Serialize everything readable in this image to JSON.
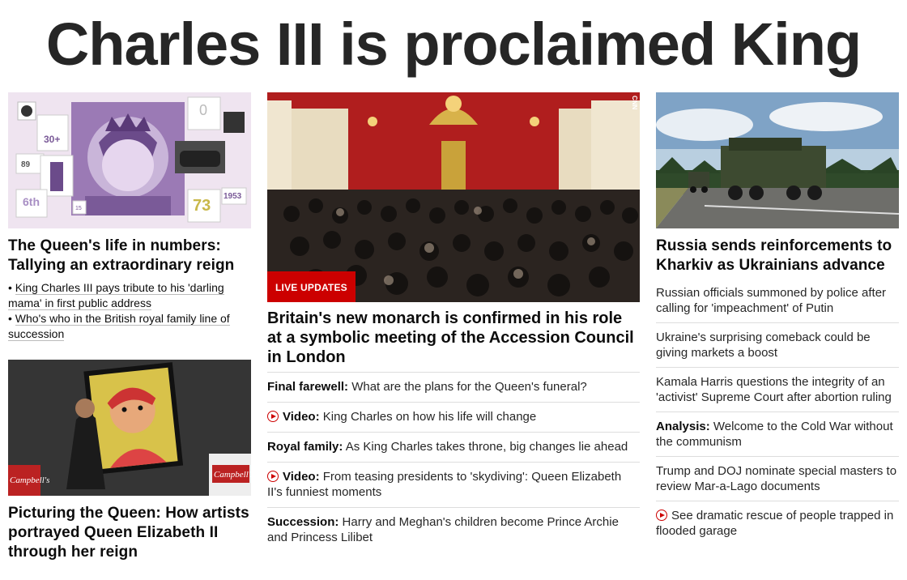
{
  "headline": "Charles III is proclaimed King",
  "left": {
    "card1": {
      "title": "The Queen's life in numbers: Tallying an extraordinary reign",
      "image_texts": [
        "30+",
        "89",
        "73",
        "1953",
        "6th",
        "0",
        "15"
      ],
      "links": [
        "King Charles III pays tribute to his 'darling mama' in first public address",
        "Who's who in the British royal family line of succession"
      ]
    },
    "card2": {
      "title": "Picturing the Queen: How artists portrayed Queen Elizabeth II through her reign",
      "image_texts": [
        "Campbell's",
        "Campbell's"
      ]
    }
  },
  "middle": {
    "badge": "LIVE UPDATES",
    "image_credit": "CNN",
    "title": "Britain's new monarch is confirmed in his role at a symbolic meeting of the Accession Council in London",
    "items": [
      {
        "label": "Final farewell:",
        "text": "What are the plans for the Queen's funeral?",
        "video": false
      },
      {
        "label": "Video:",
        "text": "King Charles on how his life will change",
        "video": true
      },
      {
        "label": "Royal family:",
        "text": "As King Charles takes throne, big changes lie ahead",
        "video": false
      },
      {
        "label": "Video:",
        "text": "From teasing presidents to 'skydiving': Queen Elizabeth II's funniest moments",
        "video": true
      },
      {
        "label": "Succession:",
        "text": "Harry and Meghan's children become Prince Archie and Princess Lilibet",
        "video": false
      }
    ]
  },
  "right": {
    "title": "Russia sends reinforcements to Kharkiv as Ukrainians advance",
    "items": [
      {
        "label": "",
        "text": "Russian officials summoned by police after calling for 'impeachment' of Putin",
        "video": false
      },
      {
        "label": "",
        "text": "Ukraine's surprising comeback could be giving markets a boost",
        "video": false
      },
      {
        "label": "",
        "text": "Kamala Harris questions the integrity of an 'activist' Supreme Court after abortion ruling",
        "video": false
      },
      {
        "label": "Analysis:",
        "text": "Welcome to the Cold War without the communism",
        "video": false
      },
      {
        "label": "",
        "text": "Trump and DOJ nominate special masters to review Mar-a-Lago documents",
        "video": false
      },
      {
        "label": "",
        "text": "See dramatic rescue of people trapped in flooded garage",
        "video": true
      }
    ]
  },
  "colors": {
    "accent": "#cc0000",
    "text": "#0c0c0c",
    "headline": "#262626"
  }
}
